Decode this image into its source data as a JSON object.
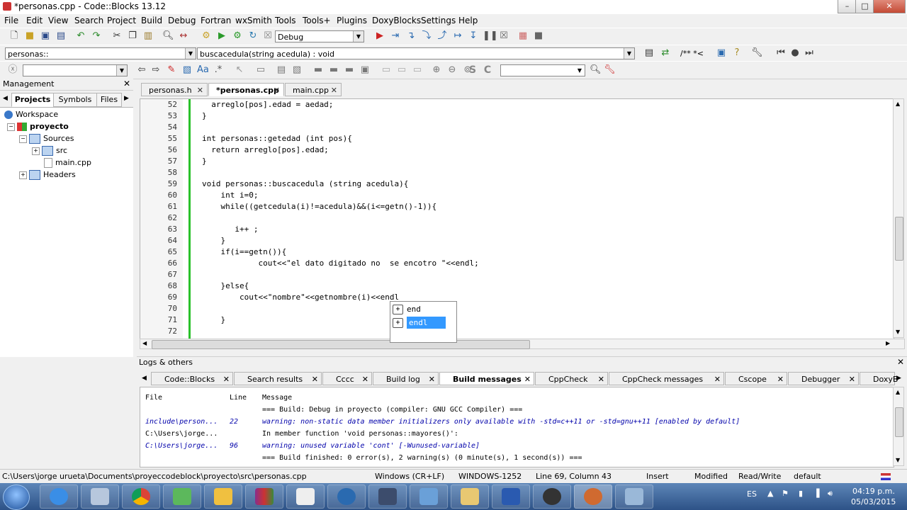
{
  "window": {
    "title": "*personas.cpp - Code::Blocks 13.12",
    "min_glyph": "–",
    "max_glyph": "□",
    "close_glyph": "✕"
  },
  "menu": [
    "File",
    "Edit",
    "View",
    "Search",
    "Project",
    "Build",
    "Debug",
    "Fortran",
    "wxSmith",
    "Tools",
    "Tools+",
    "Plugins",
    "DoxyBlocks",
    "Settings",
    "Help"
  ],
  "toolbar": {
    "build_target": "Debug",
    "scope": "personas::",
    "function": "buscacedula(string acedula) : void",
    "comment_label": "/** *<"
  },
  "management": {
    "title": "Management",
    "tabs": [
      "Projects",
      "Symbols",
      "Files"
    ],
    "tree": [
      "Workspace",
      "proyecto",
      "Sources",
      "src",
      "main.cpp",
      "Headers"
    ]
  },
  "editor": {
    "tabs": [
      "personas.h",
      "*personas.cpp",
      "main.cpp"
    ],
    "lines": [
      {
        "n": "52",
        "code": "  arreglo[pos].edad = aedad;"
      },
      {
        "n": "53",
        "code": "}"
      },
      {
        "n": "54",
        "code": ""
      },
      {
        "n": "55",
        "code": "int personas::getedad (int pos){"
      },
      {
        "n": "56",
        "code": "  return arreglo[pos].edad;"
      },
      {
        "n": "57",
        "code": "}"
      },
      {
        "n": "58",
        "code": ""
      },
      {
        "n": "59",
        "code": "void personas::buscacedula (string acedula){"
      },
      {
        "n": "60",
        "code": "    int i=0;"
      },
      {
        "n": "61",
        "code": "    while((getcedula(i)!=acedula)&&(i<=getn()-1)){"
      },
      {
        "n": "62",
        "code": ""
      },
      {
        "n": "63",
        "code": "       i++ ;"
      },
      {
        "n": "64",
        "code": "    }"
      },
      {
        "n": "65",
        "code": "    if(i==getn()){"
      },
      {
        "n": "66",
        "code": "            cout<<\"el dato digitado no  se encotro \"<<endl;"
      },
      {
        "n": "67",
        "code": ""
      },
      {
        "n": "68",
        "code": "    }else{"
      },
      {
        "n": "69",
        "code": "        cout<<\"nombre\"<<getnombre(i)<<endl"
      },
      {
        "n": "70",
        "code": ""
      },
      {
        "n": "71",
        "code": "    }"
      },
      {
        "n": "72",
        "code": ""
      }
    ],
    "autocomplete": [
      "end",
      "endl"
    ]
  },
  "logs": {
    "title": "Logs & others",
    "tabs": [
      "Code::Blocks",
      "Search results",
      "Cccc",
      "Build log",
      "Build messages",
      "CppCheck",
      "CppCheck messages",
      "Cscope",
      "Debugger",
      "DoxyB"
    ],
    "columns": [
      "File",
      "Line",
      "Message"
    ],
    "rows": [
      {
        "file": "",
        "line": "",
        "msg": "=== Build: Debug in proyecto (compiler: GNU GCC Compiler) ===",
        "warn": false
      },
      {
        "file": "include\\person...",
        "line": "22",
        "msg": "warning: non-static data member initializers only available with -std=c++11 or -std=gnu++11 [enabled by default]",
        "warn": true
      },
      {
        "file": "C:\\Users\\jorge...",
        "line": "",
        "msg": "In member function 'void personas::mayores()':",
        "warn": false
      },
      {
        "file": "C:\\Users\\jorge...",
        "line": "96",
        "msg": "warning: unused variable 'cont' [-Wunused-variable]",
        "warn": true
      },
      {
        "file": "",
        "line": "",
        "msg": "=== Build finished: 0 error(s), 2 warning(s) (0 minute(s), 1 second(s)) ===",
        "warn": false
      }
    ]
  },
  "status": {
    "path": "C:\\Users\\jorge urueta\\Documents\\proyeccodeblock\\proyecto\\src\\personas.cpp",
    "eol": "Windows (CR+LF)",
    "encoding": "WINDOWS-1252",
    "position": "Line 69, Column 43",
    "mode": "Insert",
    "modified": "Modified",
    "rw": "Read/Write",
    "profile": "default"
  },
  "taskbar": {
    "lang": "ES",
    "time": "04:19 p.m.",
    "date": "05/03/2015"
  }
}
